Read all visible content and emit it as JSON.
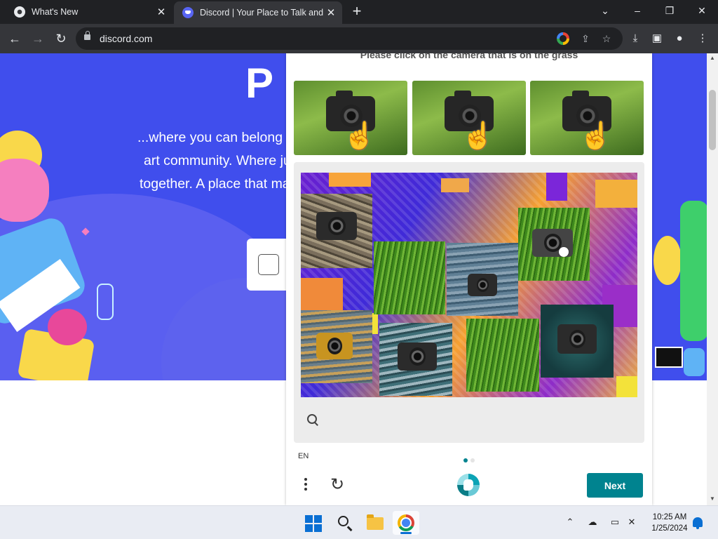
{
  "browser": {
    "tabs": [
      {
        "title": "What's New",
        "icon": "chrome-icon",
        "active": false
      },
      {
        "title": "Discord | Your Place to Talk and Hang Out",
        "icon": "discord-icon",
        "active": true
      }
    ],
    "new_tab_label": "+",
    "url": "discord.com",
    "controls": {
      "minimize": "–",
      "maximize": "❐",
      "close": "✕",
      "tab_list": "⌄"
    }
  },
  "page": {
    "hero_heading_partial": "P",
    "hero_lines": [
      "...where you can belong t",
      "art community. Where ju",
      "together. A place that ma"
    ],
    "colors": {
      "hero_bg": "#404eed",
      "captcha_accent": "#00838f"
    }
  },
  "captcha": {
    "prompt": "Please click on the camera that is on the grass",
    "examples": [
      {
        "label": "camera-in-grass-example"
      },
      {
        "label": "camera-in-grass-example"
      },
      {
        "label": "camera-in-grass-example"
      }
    ],
    "language": "EN",
    "progress": {
      "current": 1,
      "total": 2
    },
    "next_label": "Next"
  },
  "taskbar": {
    "time": "10:25 AM",
    "date": "1/25/2024",
    "apps": [
      "windows-start-icon",
      "search-icon",
      "file-explorer-icon",
      "chrome-icon"
    ]
  }
}
